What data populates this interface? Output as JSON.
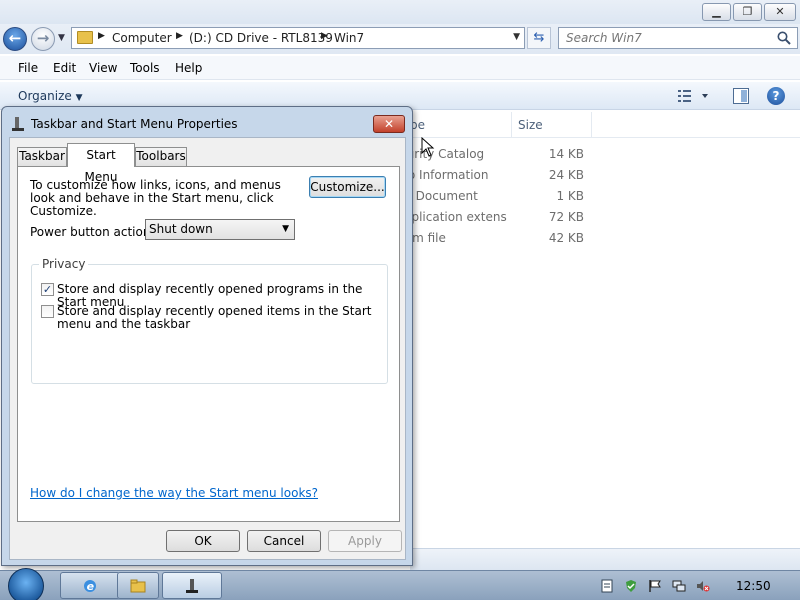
{
  "explorer": {
    "breadcrumb": [
      "Computer",
      "(D:) CD Drive - RTL8139",
      "Win7"
    ],
    "search_placeholder": "Search Win7",
    "menu": [
      "File",
      "Edit",
      "View",
      "Tools",
      "Help"
    ],
    "organize_label": "Organize",
    "columns": {
      "type": "pe",
      "size": "Size"
    },
    "files": [
      {
        "type": "curity Catalog",
        "size": "14 KB"
      },
      {
        "type": "up Information",
        "size": "24 KB"
      },
      {
        "type": "xt Document",
        "size": "1 KB"
      },
      {
        "type": "plication extens...",
        "size": "72 KB"
      },
      {
        "type": "tem file",
        "size": "42 KB"
      }
    ]
  },
  "dialog": {
    "title": "Taskbar and Start Menu Properties",
    "tabs": [
      "Taskbar",
      "Start Menu",
      "Toolbars"
    ],
    "active_tab": "Start Menu",
    "description": "To customize how links, icons, and menus look and behave in the Start menu, click Customize.",
    "customize_label": "Customize...",
    "power_label": "Power button action:",
    "power_value": "Shut down",
    "privacy_label": "Privacy",
    "privacy_options": [
      {
        "label": "Store and display recently opened programs in the Start menu",
        "checked": true
      },
      {
        "label": "Store and display recently opened items in the Start menu and the taskbar",
        "checked": false
      }
    ],
    "help_link": "How do I change the way the Start menu looks?",
    "ok_label": "OK",
    "cancel_label": "Cancel",
    "apply_label": "Apply"
  },
  "taskbar": {
    "clock": "12:50",
    "apps": [
      "internet-explorer-icon",
      "folder-icon",
      "taskbar-properties-icon"
    ],
    "tray_icons": [
      "action-center-icon",
      "security-shield-icon",
      "flag-icon",
      "network-icon",
      "volume-muted-icon"
    ]
  }
}
